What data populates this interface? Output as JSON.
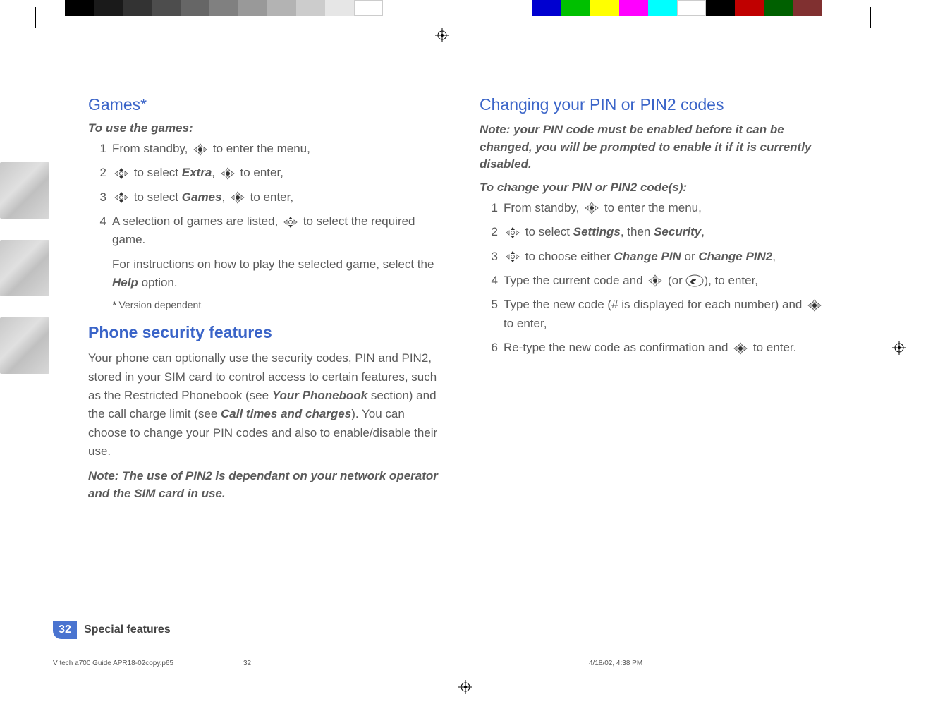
{
  "calibration": {
    "grays": [
      "#000000",
      "#1a1a1a",
      "#333333",
      "#4d4d4d",
      "#666666",
      "#808080",
      "#999999",
      "#b3b3b3",
      "#cccccc",
      "#e6e6e6",
      "#ffffff"
    ],
    "colors": [
      "#0000d0",
      "#00c000",
      "#ffff00",
      "#ff00ff",
      "#00ffff",
      "#ffffff",
      "#000000",
      "#c00000",
      "#006000",
      "#803030"
    ]
  },
  "left": {
    "h1": "Games*",
    "sub1": "To use the games:",
    "steps": [
      {
        "num": "1",
        "pre": "From standby, ",
        "icon": "nav-center",
        "post": " to enter the menu,"
      },
      {
        "num": "2",
        "icon1": "nav-updown",
        "mid1": " to select ",
        "bi1": "Extra",
        "mid2": ", ",
        "icon2": "nav-center",
        "post": " to enter,"
      },
      {
        "num": "3",
        "icon1": "nav-updown",
        "mid1": " to select ",
        "bi1": "Games",
        "mid2": ", ",
        "icon2": "nav-center",
        "post": " to enter,"
      },
      {
        "num": "4",
        "pre": "A selection of games are listed, ",
        "icon": "nav-updown",
        "post": " to select the required game."
      }
    ],
    "indent": {
      "pre": "For instructions on how to play the selected game, select the ",
      "bi": "Help",
      "post": " option."
    },
    "footnote": {
      "ast": "*",
      "text": "Version dependent"
    },
    "h2": "Phone security features",
    "para": {
      "t1": "Your phone can optionally use the security codes, PIN and PIN2, stored in your SIM card to control access to certain features, such as the Restricted Phonebook (see ",
      "bi1": "Your Phonebook",
      "t2": " section) and the call charge limit (see ",
      "bi2": "Call times and charges",
      "t3": "). You can choose to change your PIN codes and also to enable/disable their use."
    },
    "note": "Note: The use of PIN2 is dependant on your network operator and the SIM card in use."
  },
  "right": {
    "h1": "Changing your PIN or PIN2 codes",
    "note": "Note: your PIN code must be enabled before it can be changed, you will be prompted to enable it if it is currently disabled.",
    "sub1": "To change your PIN or PIN2 code(s):",
    "steps": [
      {
        "num": "1",
        "pre": "From standby, ",
        "icon": "nav-center",
        "post": " to enter the menu,"
      },
      {
        "num": "2",
        "icon1": "nav-updown",
        "mid1": " to select ",
        "bi1": "Settings",
        "mid2": ", then ",
        "bi2": "Security",
        "post": ","
      },
      {
        "num": "3",
        "icon1": "nav-updown",
        "mid1": " to choose either ",
        "bi1": "Change PIN",
        "mid2": " or ",
        "bi2": "Change PIN2",
        "post": ","
      },
      {
        "num": "4",
        "pre": "Type the current code and ",
        "icon": "nav-center",
        "mid": " (or ",
        "icon2": "call",
        "post": "), to enter,"
      },
      {
        "num": "5",
        "pre": "Type the new code (# is displayed for each number) and ",
        "icon": "nav-center",
        "post": " to enter,"
      },
      {
        "num": "6",
        "pre": "Re-type the new code as confirmation and ",
        "icon": "nav-center",
        "post": " to enter."
      }
    ]
  },
  "footer": {
    "pageNum": "32",
    "chapter": "Special features",
    "filename": "V tech a700 Guide APR18-02copy.p65",
    "printPage": "32",
    "printDate": "4/18/02, 4:38 PM"
  }
}
